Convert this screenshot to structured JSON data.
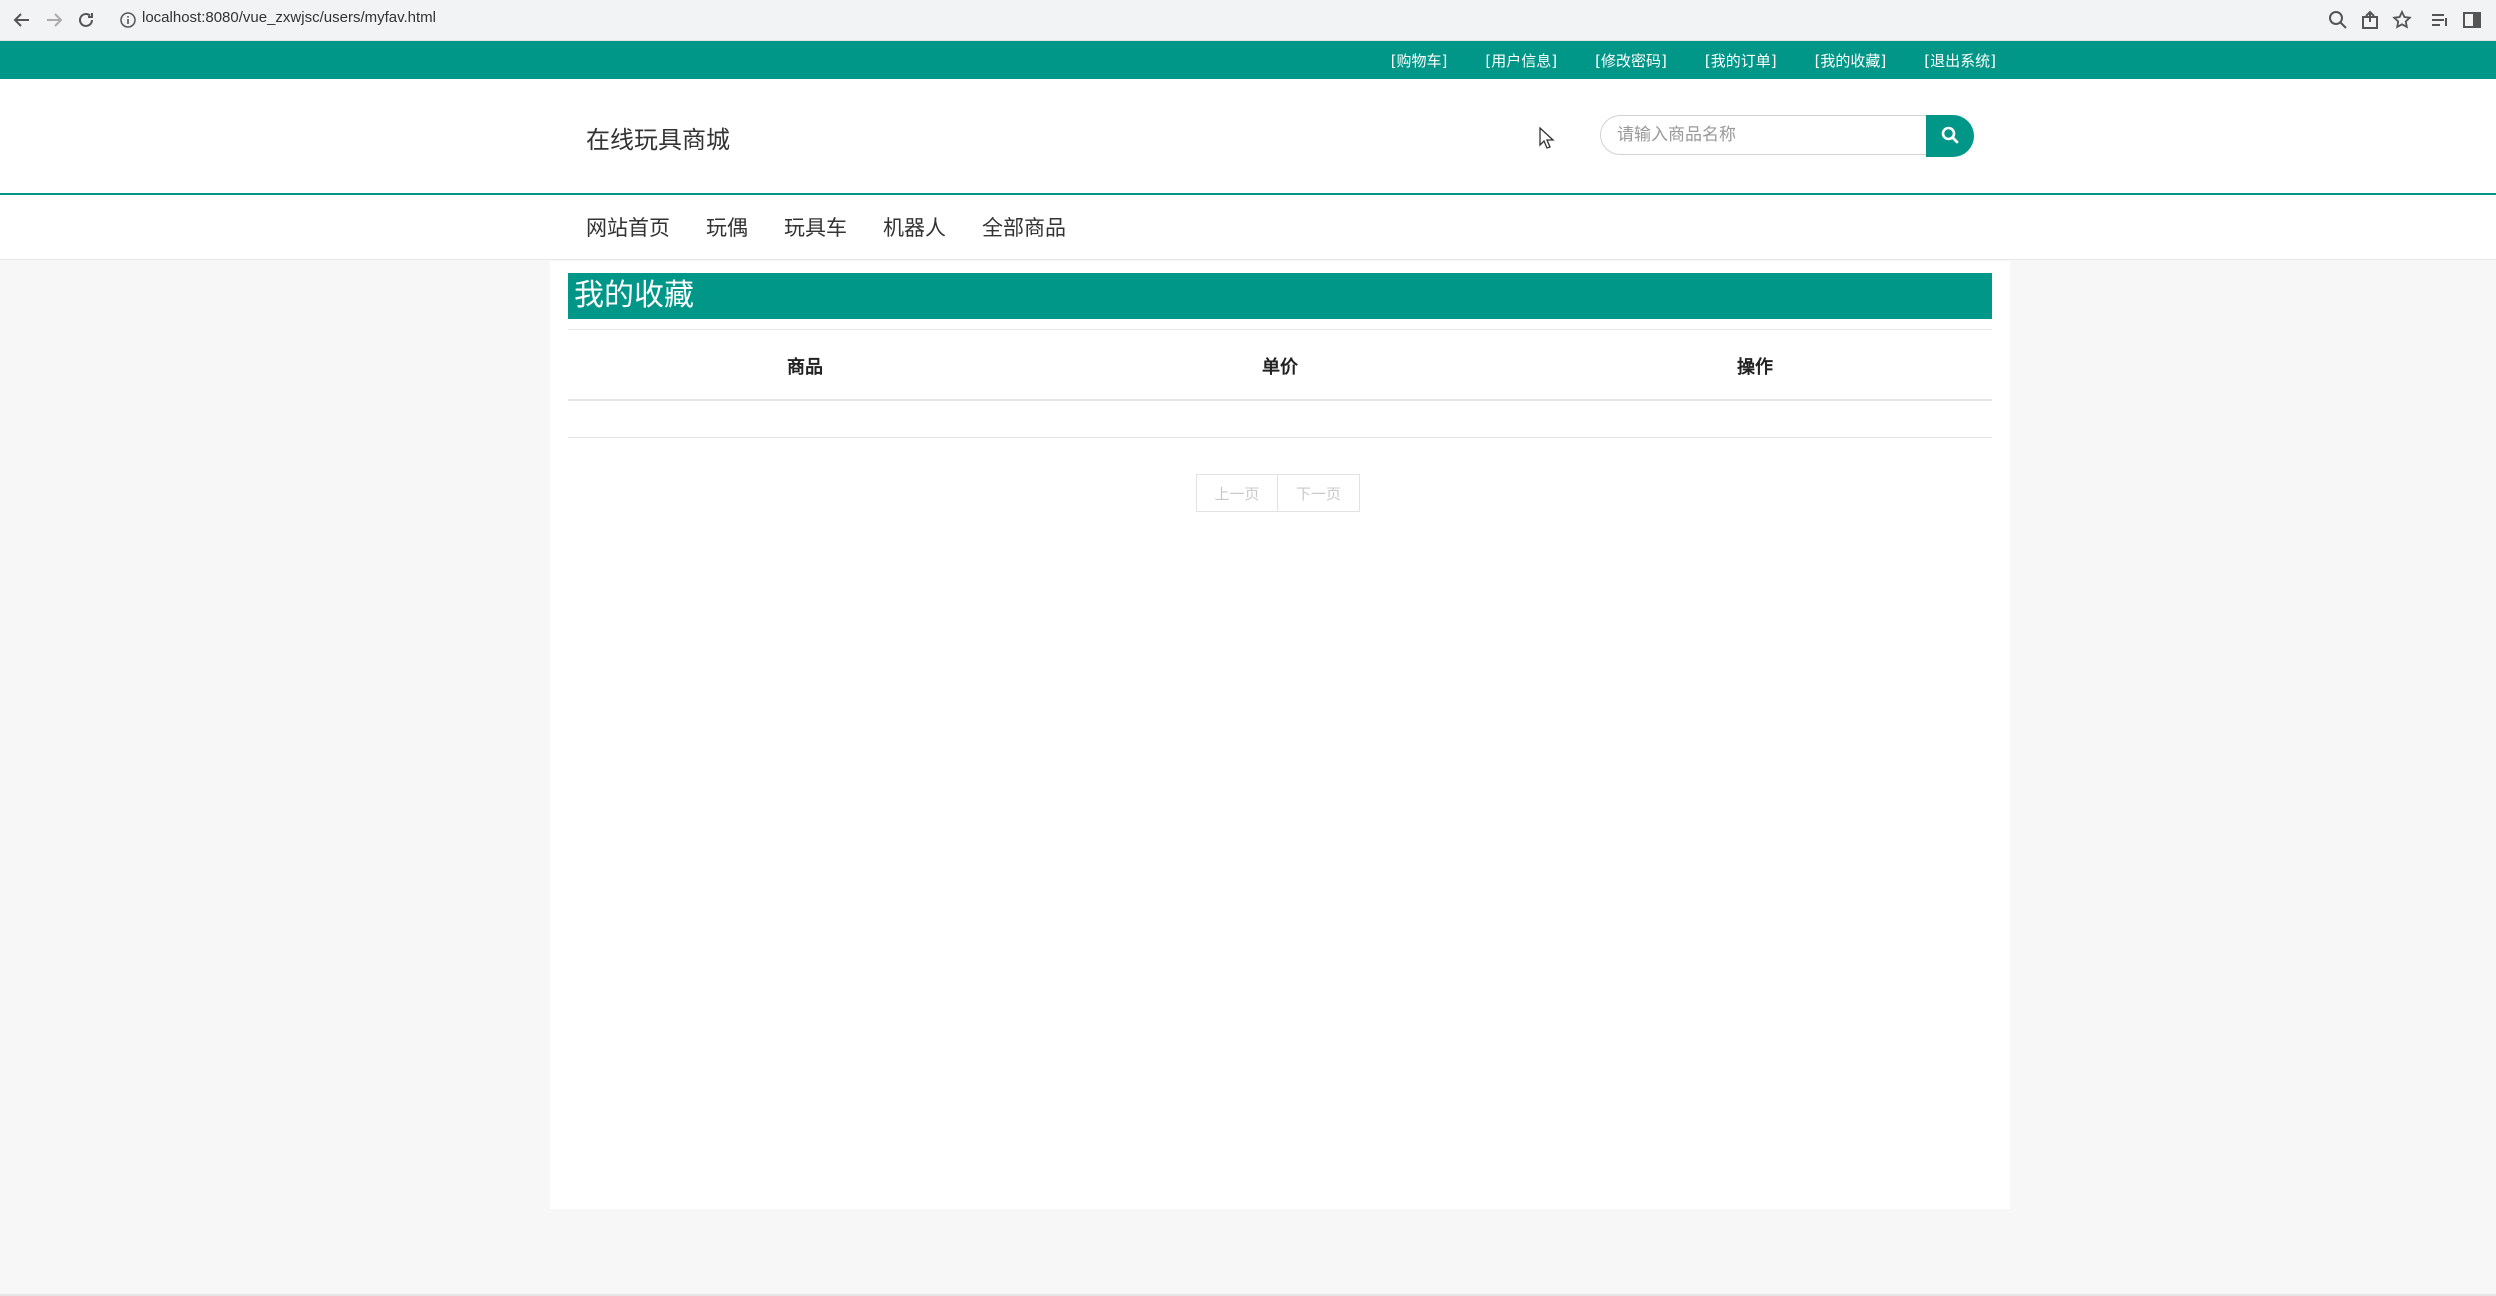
{
  "browser": {
    "url": "localhost:8080/vue_zxwjsc/users/myfav.html"
  },
  "top_links": [
    "[购物车]",
    "[用户信息]",
    "[修改密码]",
    "[我的订单]",
    "[我的收藏]",
    "[退出系统]"
  ],
  "header": {
    "site_title": "在线玩具商城",
    "search_placeholder": "请输入商品名称"
  },
  "categories": [
    "网站首页",
    "玩偶",
    "玩具车",
    "机器人",
    "全部商品"
  ],
  "main": {
    "section_title": "我的收藏",
    "columns": [
      "商品",
      "单价",
      "操作"
    ],
    "rows": [],
    "prev_label": "上一页",
    "next_label": "下一页"
  },
  "colors": {
    "accent": "#009688",
    "background": "#f7f7f7"
  }
}
